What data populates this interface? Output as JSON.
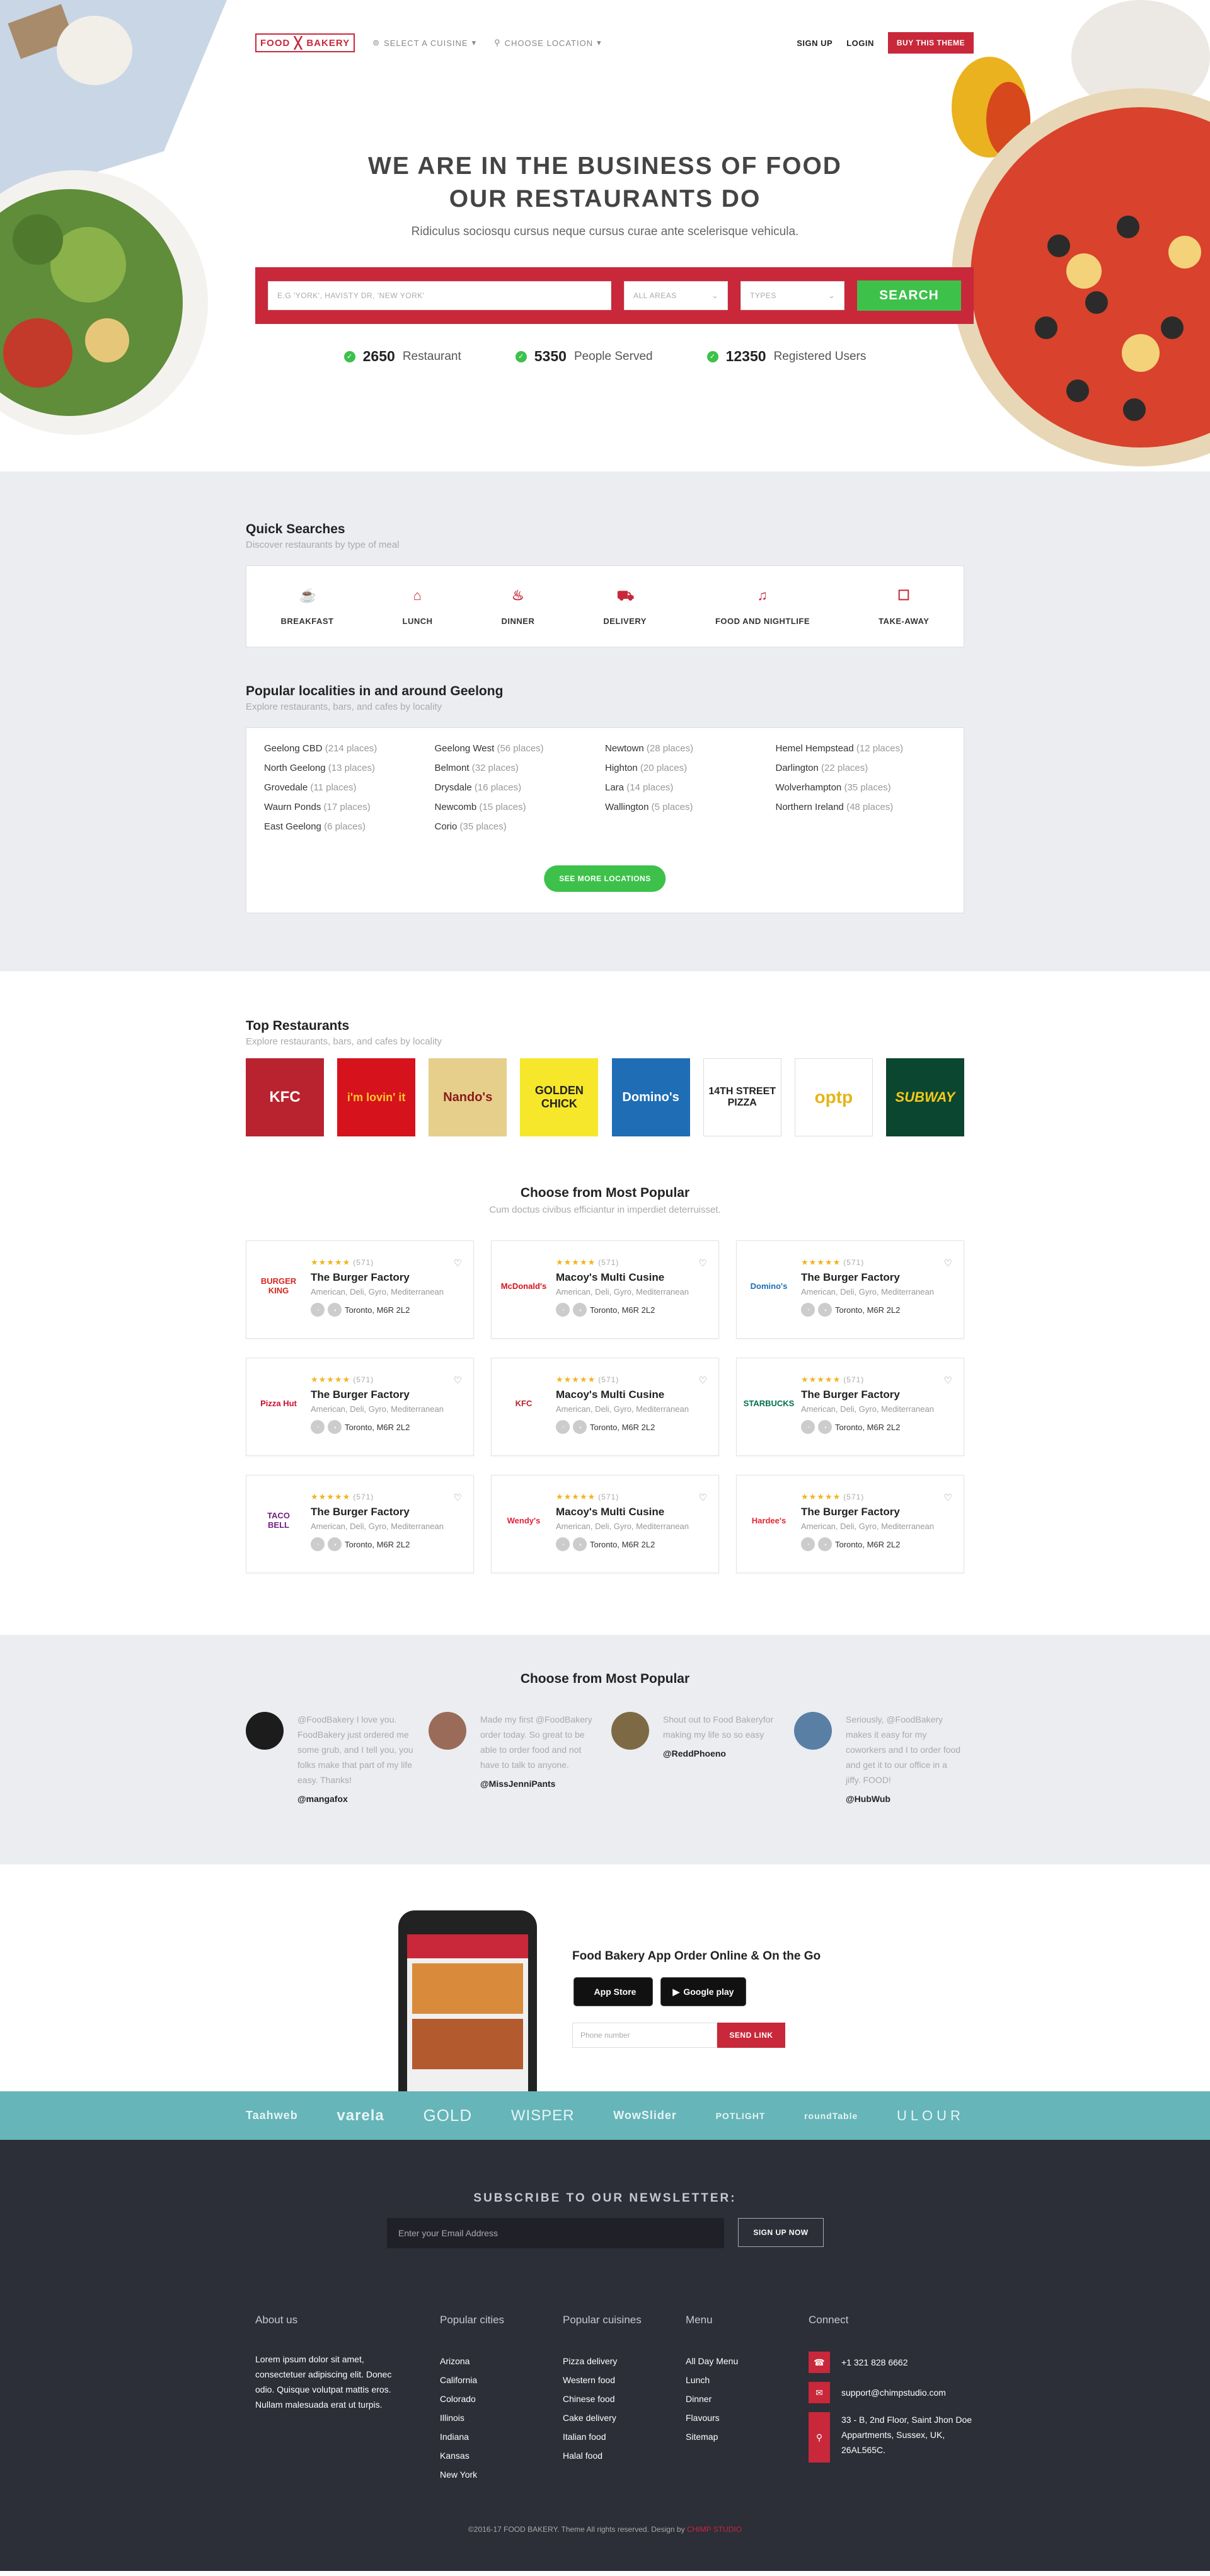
{
  "header": {
    "logo_left": "FOOD",
    "logo_right": "BAKERY",
    "select_cuisine": "SELECT A CUISINE",
    "choose_location": "CHOOSE LOCATION",
    "signup": "SIGN UP",
    "login": "LOGIN",
    "buy": "BUY THIS THEME"
  },
  "hero": {
    "title_line1": "WE ARE IN THE BUSINESS OF FOOD",
    "title_line2": "OUR RESTAURANTS DO",
    "subtitle": "Ridiculus sociosqu cursus neque cursus curae ante scelerisque vehicula.",
    "search_placeholder": "E.G 'YORK', HAVISTY DR, 'NEW YORK'",
    "area_select": "ALL AREAS",
    "types_select": "TYPES",
    "search_button": "SEARCH",
    "stats": [
      {
        "value": "2650",
        "label": "Restaurant"
      },
      {
        "value": "5350",
        "label": "People Served"
      },
      {
        "value": "12350",
        "label": "Registered Users"
      }
    ]
  },
  "quick": {
    "title": "Quick Searches",
    "subtitle": "Discover restaurants by type of meal",
    "items": [
      {
        "label": "BREAKFAST",
        "icon": "breakfast-icon"
      },
      {
        "label": "LUNCH",
        "icon": "lunch-icon"
      },
      {
        "label": "DINNER",
        "icon": "dinner-icon"
      },
      {
        "label": "DELIVERY",
        "icon": "delivery-icon"
      },
      {
        "label": "FOOD AND NIGHTLIFE",
        "icon": "nightlife-icon"
      },
      {
        "label": "TAKE-AWAY",
        "icon": "takeaway-icon"
      }
    ]
  },
  "localities": {
    "title": "Popular localities in and around Geelong",
    "subtitle": "Explore restaurants, bars, and cafes by locality",
    "items": [
      {
        "name": "Geelong CBD",
        "count": "(214 places)"
      },
      {
        "name": "Geelong West",
        "count": "(56 places)"
      },
      {
        "name": "Newtown",
        "count": "(28 places)"
      },
      {
        "name": "Hemel Hempstead",
        "count": "(12 places)"
      },
      {
        "name": "North Geelong",
        "count": "(13 places)"
      },
      {
        "name": "Belmont",
        "count": "(32 places)"
      },
      {
        "name": "Highton",
        "count": "(20 places)"
      },
      {
        "name": "Darlington",
        "count": "(22 places)"
      },
      {
        "name": "Grovedale",
        "count": "(11 places)"
      },
      {
        "name": "Drysdale",
        "count": "(16 places)"
      },
      {
        "name": "Lara",
        "count": "(14 places)"
      },
      {
        "name": "Wolverhampton",
        "count": "(35 places)"
      },
      {
        "name": "Waurn Ponds",
        "count": "(17 places)"
      },
      {
        "name": "Newcomb",
        "count": "(15 places)"
      },
      {
        "name": "Wallington",
        "count": "(5 places)"
      },
      {
        "name": "Northern Ireland",
        "count": "(48 places)"
      },
      {
        "name": "East Geelong",
        "count": "(6 places)"
      },
      {
        "name": "Corio",
        "count": "(35 places)"
      }
    ],
    "see_more": "SEE MORE LOCATIONS"
  },
  "top": {
    "title": "Top Restaurants",
    "subtitle": "Explore restaurants, bars, and cafes by locality",
    "brands": [
      {
        "name": "KFC",
        "bg": "#b8232f",
        "fg": "#fff"
      },
      {
        "name": "i'm lovin' it",
        "bg": "#d6121c",
        "fg": "#ffc72c"
      },
      {
        "name": "Nando's",
        "bg": "#e5cf8a",
        "fg": "#8a1a1a"
      },
      {
        "name": "GOLDEN CHICK",
        "bg": "#f6e72a",
        "fg": "#222"
      },
      {
        "name": "Domino's",
        "bg": "#1f6db5",
        "fg": "#fff"
      },
      {
        "name": "14TH STREET PIZZA",
        "bg": "#fff",
        "fg": "#222"
      },
      {
        "name": "optp",
        "bg": "#fff",
        "fg": "#e4b515"
      },
      {
        "name": "SUBWAY",
        "bg": "#0b4631",
        "fg": "#f6c91a"
      }
    ]
  },
  "popular": {
    "title": "Choose from Most Popular",
    "subtitle": "Cum doctus civibus efficiantur in imperdiet deterruisset.",
    "cards": [
      {
        "logo": "BURGER KING",
        "logo_color": "#d5261f",
        "rating": "(571)",
        "name": "The Burger Factory",
        "cuisine": "American, Deli, Gyro, Mediterranean",
        "location": "Toronto, M6R 2L2"
      },
      {
        "logo": "McDonald's",
        "logo_color": "#d6121c",
        "rating": "(571)",
        "name": "Macoy's Multi Cusine",
        "cuisine": "American, Deli, Gyro, Mediterranean",
        "location": "Toronto, M6R 2L2"
      },
      {
        "logo": "Domino's",
        "logo_color": "#1f6db5",
        "rating": "(571)",
        "name": "The Burger Factory",
        "cuisine": "American, Deli, Gyro, Mediterranean",
        "location": "Toronto, M6R 2L2"
      },
      {
        "logo": "Pizza Hut",
        "logo_color": "#c8102e",
        "rating": "(571)",
        "name": "The Burger Factory",
        "cuisine": "American, Deli, Gyro, Mediterranean",
        "location": "Toronto, M6R 2L2"
      },
      {
        "logo": "KFC",
        "logo_color": "#b8232f",
        "rating": "(571)",
        "name": "Macoy's Multi Cusine",
        "cuisine": "American, Deli, Gyro, Mediterranean",
        "location": "Toronto, M6R 2L2"
      },
      {
        "logo": "STARBUCKS",
        "logo_color": "#00704a",
        "rating": "(571)",
        "name": "The Burger Factory",
        "cuisine": "American, Deli, Gyro, Mediterranean",
        "location": "Toronto, M6R 2L2"
      },
      {
        "logo": "TACO BELL",
        "logo_color": "#702082",
        "rating": "(571)",
        "name": "The Burger Factory",
        "cuisine": "American, Deli, Gyro, Mediterranean",
        "location": "Toronto, M6R 2L2"
      },
      {
        "logo": "Wendy's",
        "logo_color": "#e2203d",
        "rating": "(571)",
        "name": "Macoy's Multi Cusine",
        "cuisine": "American, Deli, Gyro, Mediterranean",
        "location": "Toronto, M6R 2L2"
      },
      {
        "logo": "Hardee's",
        "logo_color": "#e4262f",
        "rating": "(571)",
        "name": "The Burger Factory",
        "cuisine": "American, Deli, Gyro, Mediterranean",
        "location": "Toronto, M6R 2L2"
      }
    ]
  },
  "testimonials": {
    "title": "Choose from Most Popular",
    "items": [
      {
        "text": "@FoodBakery I love you. FoodBakery just ordered me some grub, and I tell you, you folks make that part of my life easy. Thanks!",
        "handle": "@mangafox",
        "avatar": "#1c1c1c"
      },
      {
        "text": "Made my first @FoodBakery order today. So great to be able to order food and not have to talk to anyone.",
        "handle": "@MissJenniPants",
        "avatar": "#9b6b5a"
      },
      {
        "text": "Shout out to Food Bakeryfor making my life so so easy",
        "handle": "@ReddPhoeno",
        "avatar": "#7d6a45"
      },
      {
        "text": "Seriously, @FoodBakery makes it easy for my coworkers and I to order food and get it to our office in a jiffy. FOOD!",
        "handle": "@HubWub",
        "avatar": "#5a7fa5"
      }
    ]
  },
  "app": {
    "title": "Food Bakery App Order Online & On the Go",
    "appstore": "App Store",
    "googleplay": "Google play",
    "phone_placeholder": "Phone number",
    "send": "SEND LINK"
  },
  "partners": [
    "Taahweb",
    "varela",
    "GOLD",
    "WISPER",
    "WowSlider",
    "POTLIGHT",
    "roundTable",
    "ULOUR"
  ],
  "footer": {
    "newsletter_title": "SUBSCRIBE TO OUR NEWSLETTER:",
    "email_placeholder": "Enter your Email Address",
    "signup": "SIGN UP NOW",
    "about_title": "About us",
    "about_text": "Lorem ipsum dolor sit amet, consectetuer adipiscing elit. Donec odio. Quisque volutpat mattis eros. Nullam malesuada erat ut turpis.",
    "cities_title": "Popular cities",
    "cities": [
      "Arizona",
      "California",
      "Colorado",
      "Illinois",
      "Indiana",
      "Kansas",
      "New York"
    ],
    "cuisines_title": "Popular cuisines",
    "cuisines": [
      "Pizza delivery",
      "Western food",
      "Chinese food",
      "Cake delivery",
      "Italian food",
      "Halal food"
    ],
    "menu_title": "Menu",
    "menu": [
      "All Day Menu",
      "Lunch",
      "Dinner",
      "Flavours",
      "Sitemap"
    ],
    "connect_title": "Connect",
    "phone": "+1 321 828 6662",
    "email": "support@chimpstudio.com",
    "address": "33 - B, 2nd Floor, Saint Jhon Doe Appartments, Sussex, UK, 26AL565C.",
    "copyright": "©2016-17 FOOD BAKERY. Theme All rights reserved. Design by",
    "studio": "CHIMP STUDIO"
  }
}
